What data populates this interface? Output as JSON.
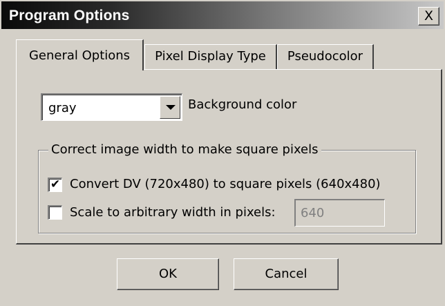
{
  "window": {
    "title": "Program Options",
    "close_glyph": "X",
    "close_icon": "close-icon"
  },
  "tabs": [
    {
      "label": "General Options",
      "active": true
    },
    {
      "label": "Pixel Display Type",
      "active": false
    },
    {
      "label": "Pseudocolor",
      "active": false
    }
  ],
  "general": {
    "background_select": {
      "value": "gray",
      "label": "Background color",
      "arrow_icon": "dropdown-arrow-icon"
    },
    "square_pixels_group": {
      "title": "Correct image width to make square pixels",
      "convert_dv": {
        "label": "Convert DV (720x480) to square pixels (640x480)",
        "checked": true,
        "check_glyph": "✔"
      },
      "scale_arbitrary": {
        "label": "Scale to arbitrary width in pixels:",
        "checked": false,
        "check_glyph": ""
      },
      "width_value": "640"
    }
  },
  "buttons": {
    "ok": "OK",
    "cancel": "Cancel"
  },
  "colors": {
    "face": "#d4d0c8",
    "title_gradient_start": "#0a0a0a",
    "title_gradient_end": "#c8c8c8",
    "disabled_text": "#808080"
  }
}
